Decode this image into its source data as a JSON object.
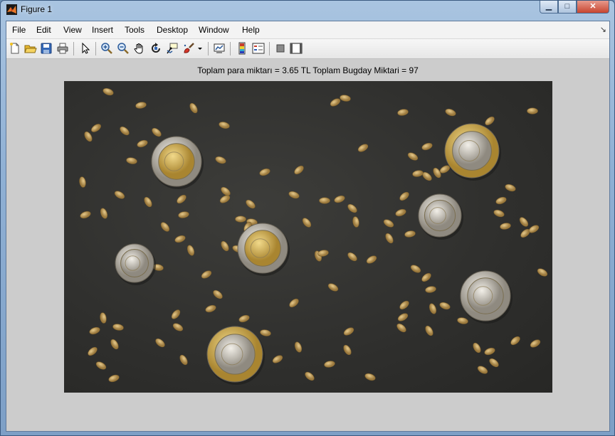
{
  "window": {
    "title": "Figure 1",
    "controls": {
      "minimize": "▁",
      "maximize": "□",
      "close": "✕"
    }
  },
  "menu": {
    "items": [
      "File",
      "Edit",
      "View",
      "Insert",
      "Tools",
      "Desktop",
      "Window",
      "Help"
    ],
    "dock_arrow": "↘"
  },
  "toolbar": {
    "tools": [
      "new-figure-icon",
      "open-file-icon",
      "save-icon",
      "print-icon",
      "edit-plot-arrow-icon",
      "zoom-in-icon",
      "zoom-out-icon",
      "pan-hand-icon",
      "rotate-3d-icon",
      "data-cursor-icon",
      "brush-icon",
      "brush-dropdown-icon",
      "link-plot-icon",
      "insert-colorbar-icon",
      "insert-legend-icon",
      "hide-plot-tools-icon",
      "show-plot-tools-icon"
    ]
  },
  "figure": {
    "title": "Toplam para miktarı = 3.65 TL   Toplam Bugday Miktari = 97"
  },
  "colors": {
    "figure_bg": "#cccccc",
    "photo_bg": "#30302e",
    "grain": "#c9a86a",
    "coin_silver": "#cfcac0",
    "coin_gold": "#d6b35a"
  }
}
